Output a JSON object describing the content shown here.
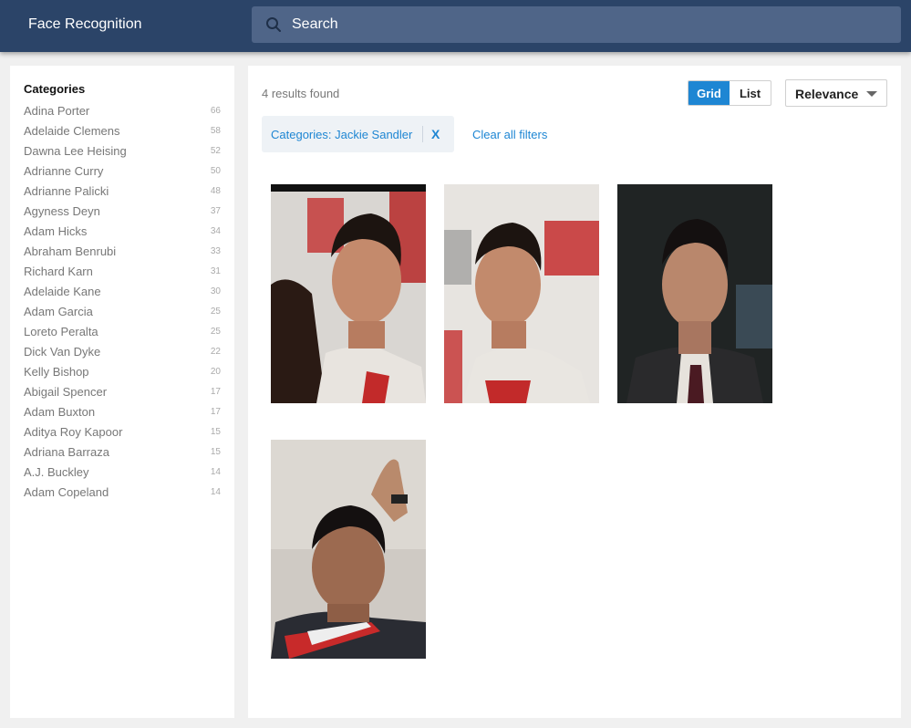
{
  "app": {
    "title": "Face Recognition"
  },
  "search": {
    "placeholder": "Search",
    "icon": "search-icon"
  },
  "sidebar": {
    "title": "Categories",
    "items": [
      {
        "label": "Adina Porter",
        "count": "66"
      },
      {
        "label": "Adelaide Clemens",
        "count": "58"
      },
      {
        "label": "Dawna Lee Heising",
        "count": "52"
      },
      {
        "label": "Adrianne Curry",
        "count": "50"
      },
      {
        "label": "Adrianne Palicki",
        "count": "48"
      },
      {
        "label": "Agyness Deyn",
        "count": "37"
      },
      {
        "label": "Adam Hicks",
        "count": "34"
      },
      {
        "label": "Abraham Benrubi",
        "count": "33"
      },
      {
        "label": "Richard Karn",
        "count": "31"
      },
      {
        "label": "Adelaide Kane",
        "count": "30"
      },
      {
        "label": "Adam Garcia",
        "count": "25"
      },
      {
        "label": "Loreto Peralta",
        "count": "25"
      },
      {
        "label": "Dick Van Dyke",
        "count": "22"
      },
      {
        "label": "Kelly Bishop",
        "count": "20"
      },
      {
        "label": "Abigail Spencer",
        "count": "17"
      },
      {
        "label": "Adam Buxton",
        "count": "17"
      },
      {
        "label": "Aditya Roy Kapoor",
        "count": "15"
      },
      {
        "label": "Adriana Barraza",
        "count": "15"
      },
      {
        "label": "A.J. Buckley",
        "count": "14"
      },
      {
        "label": "Adam Copeland",
        "count": "14"
      }
    ]
  },
  "results": {
    "count_text": "4 results found",
    "view_grid": "Grid",
    "view_list": "List",
    "active_view": "Grid",
    "sort_selected": "Relevance",
    "filter_chip": "Categories: Jackie Sandler",
    "filter_remove": "X",
    "clear_all": "Clear all filters"
  },
  "colors": {
    "header": "#2b4468",
    "search_bg": "#4f6588",
    "accent": "#1e86d3",
    "page_bg": "#f0f0f0"
  }
}
